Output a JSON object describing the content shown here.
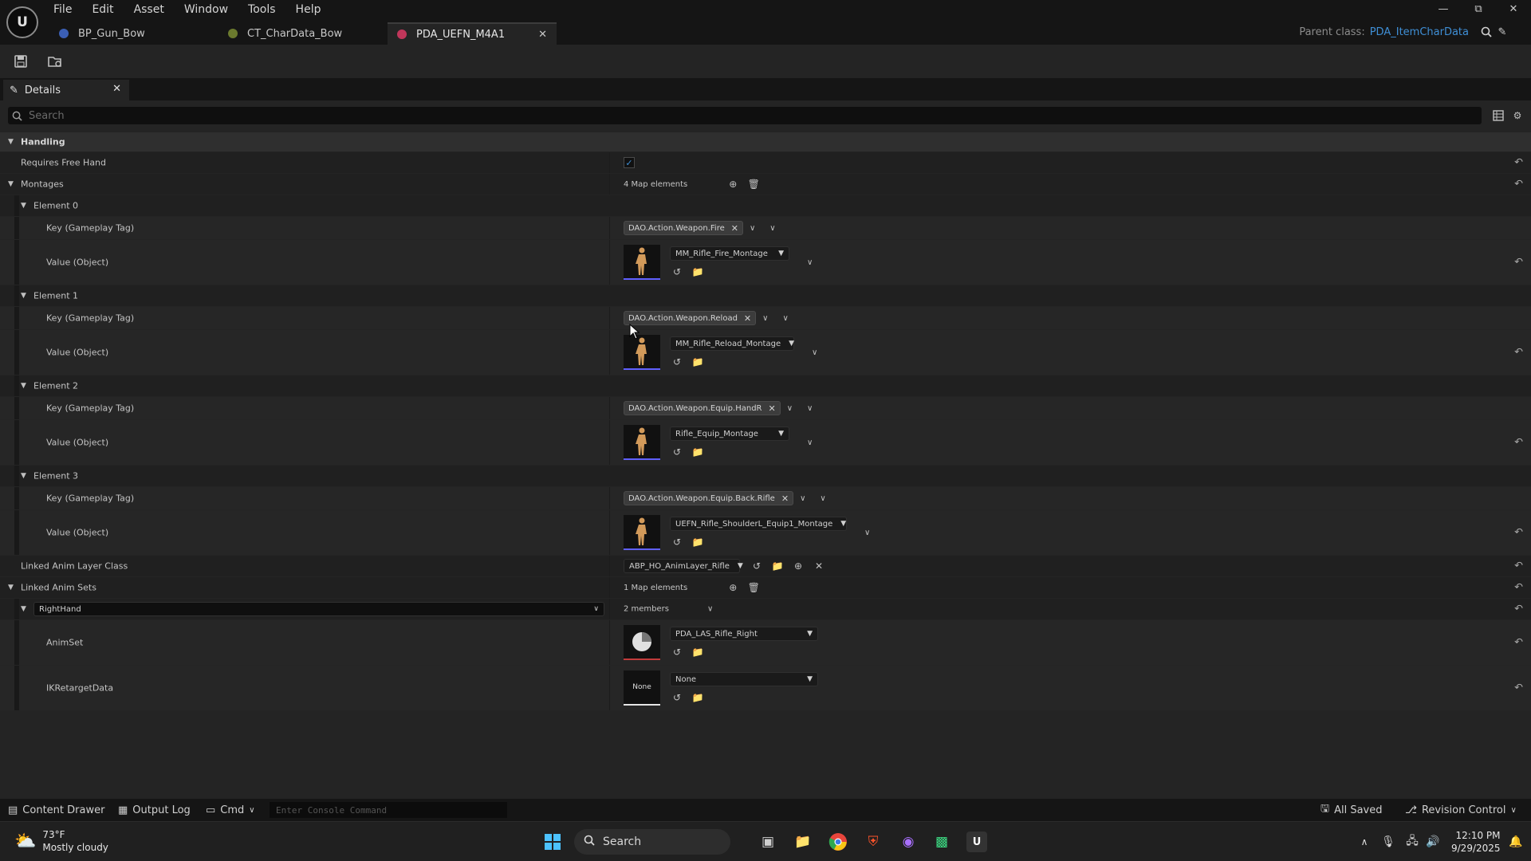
{
  "menu": [
    "File",
    "Edit",
    "Asset",
    "Window",
    "Tools",
    "Help"
  ],
  "tabs": [
    {
      "label": "BP_Gun_Bow",
      "color": "#3b5fb5"
    },
    {
      "label": "CT_CharData_Bow",
      "color": "#6b7a2e"
    },
    {
      "label": "PDA_UEFN_M4A1",
      "color": "#c0365a"
    }
  ],
  "parent_class": {
    "label": "Parent class:",
    "value": "PDA_ItemCharData"
  },
  "details": {
    "tab_label": "Details",
    "search_placeholder": "Search",
    "handling_label": "Handling",
    "requires_free_hand_label": "Requires Free Hand",
    "montages_label": "Montages",
    "montages_count": "4 Map elements",
    "elements": [
      {
        "label": "Element 0",
        "key_label": "Key (Gameplay Tag)",
        "tag": "DAO.Action.Weapon.Fire",
        "value_label": "Value (Object)",
        "asset": "MM_Rifle_Fire_Montage"
      },
      {
        "label": "Element 1",
        "key_label": "Key (Gameplay Tag)",
        "tag": "DAO.Action.Weapon.Reload",
        "value_label": "Value (Object)",
        "asset": "MM_Rifle_Reload_Montage"
      },
      {
        "label": "Element 2",
        "key_label": "Key (Gameplay Tag)",
        "tag": "DAO.Action.Weapon.Equip.HandR",
        "value_label": "Value (Object)",
        "asset": "Rifle_Equip_Montage"
      },
      {
        "label": "Element 3",
        "key_label": "Key (Gameplay Tag)",
        "tag": "DAO.Action.Weapon.Equip.Back.Rifle",
        "value_label": "Value (Object)",
        "asset": "UEFN_Rifle_ShoulderL_Equip1_Montage"
      }
    ],
    "linked_anim_layer_label": "Linked Anim Layer Class",
    "linked_anim_layer_value": "ABP_HO_AnimLayer_Rifle",
    "linked_anim_sets_label": "Linked Anim Sets",
    "linked_anim_sets_count": "1 Map elements",
    "right_hand_key": "RightHand",
    "members": "2 members",
    "animset_label": "AnimSet",
    "animset_value": "PDA_LAS_Rifle_Right",
    "ikretarget_label": "IKRetargetData",
    "ikretarget_value": "None",
    "ikretarget_thumb": "None"
  },
  "status": {
    "content_drawer": "Content Drawer",
    "output_log": "Output Log",
    "cmd": "Cmd",
    "console_placeholder": "Enter Console Command",
    "all_saved": "All Saved",
    "revision_control": "Revision Control"
  },
  "taskbar": {
    "temp": "73°F",
    "weather": "Mostly cloudy",
    "search": "Search",
    "time": "12:10 PM",
    "date": "9/29/2025"
  }
}
